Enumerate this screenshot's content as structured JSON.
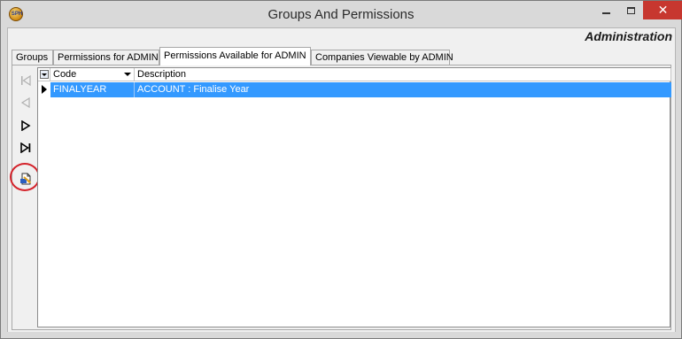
{
  "window": {
    "title": "Groups And Permissions",
    "app_icon_text": "SPH",
    "close_label": "✕"
  },
  "header": {
    "heading": "Administration"
  },
  "tabs": [
    {
      "label": "Groups",
      "active": false
    },
    {
      "label": "Permissions for ADMIN",
      "active": false
    },
    {
      "label": "Permissions Available for ADMIN",
      "active": true
    },
    {
      "label": "Companies Viewable by ADMIN",
      "active": false
    }
  ],
  "navigator": {
    "buttons": [
      "first-record-icon",
      "previous-record-icon",
      "next-record-icon",
      "last-record-icon",
      "export-document-icon"
    ]
  },
  "grid": {
    "columns": [
      "Code",
      "Description"
    ],
    "rows": [
      {
        "code": "FINALYEAR",
        "description": "ACCOUNT : Finalise Year",
        "selected": true
      }
    ]
  },
  "colors": {
    "selection": "#3399ff",
    "close_button": "#c7372f",
    "highlight_ring": "#d4232b"
  }
}
